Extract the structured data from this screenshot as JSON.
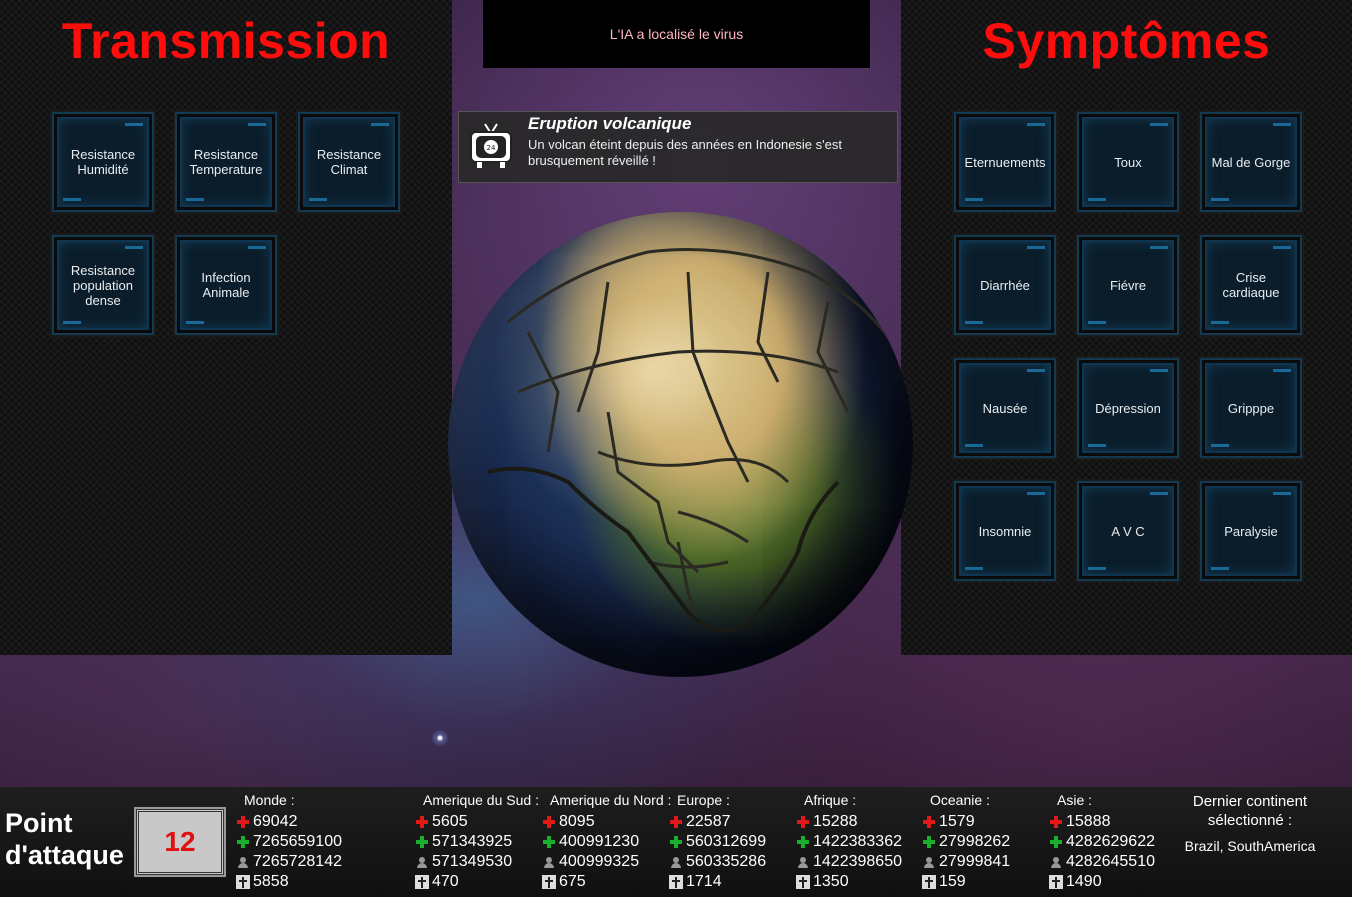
{
  "transmission": {
    "title": "Transmission",
    "tiles": [
      {
        "label": "Resistance\nHumidité"
      },
      {
        "label": "Resistance\nTemperature"
      },
      {
        "label": "Resistance\nClimat"
      },
      {
        "label": "Resistance\npopulation\ndense"
      },
      {
        "label": "Infection\nAnimale"
      }
    ]
  },
  "symptoms": {
    "title": "Symptômes",
    "tiles": [
      {
        "label": "Eternuements"
      },
      {
        "label": "Toux"
      },
      {
        "label": "Mal de Gorge"
      },
      {
        "label": "Diarrhée"
      },
      {
        "label": "Fiévre"
      },
      {
        "label": "Crise\ncardiaque"
      },
      {
        "label": "Nausée"
      },
      {
        "label": "Dépression"
      },
      {
        "label": "Gripppe"
      },
      {
        "label": "Insomnie"
      },
      {
        "label": "A V C"
      },
      {
        "label": "Paralysie"
      }
    ]
  },
  "banner": {
    "text": "L'IA a localisé le virus"
  },
  "news": {
    "icon": "tv-icon",
    "title": "Eruption volcanique",
    "body": "Un volcan éteint depuis des années en Indonesie s'est brusquement réveillé !"
  },
  "attack_points": {
    "label_line1": "Point",
    "label_line2": "d'attaque",
    "value": "12"
  },
  "stats": [
    {
      "name": "Monde :",
      "infected": "69042",
      "healthy": "7265659100",
      "population": "7265728142",
      "dead": "5858"
    },
    {
      "name": "Amerique du Sud :",
      "infected": "5605",
      "healthy": "571343925",
      "population": "571349530",
      "dead": "470"
    },
    {
      "name": "Amerique du Nord :",
      "infected": "8095",
      "healthy": "400991230",
      "population": "400999325",
      "dead": "675"
    },
    {
      "name": "Europe :",
      "infected": "22587",
      "healthy": "560312699",
      "population": "560335286",
      "dead": "1714"
    },
    {
      "name": "Afrique :",
      "infected": "15288",
      "healthy": "1422383362",
      "population": "1422398650",
      "dead": "1350"
    },
    {
      "name": "Oceanie :",
      "infected": "1579",
      "healthy": "27998262",
      "population": "27999841",
      "dead": "159"
    },
    {
      "name": "Asie :",
      "infected": "15888",
      "healthy": "4282629622",
      "population": "4282645510",
      "dead": "1490"
    }
  ],
  "last_continent": {
    "label": "Dernier continent sélectionné :",
    "value": "Brazil, SouthAmerica"
  }
}
